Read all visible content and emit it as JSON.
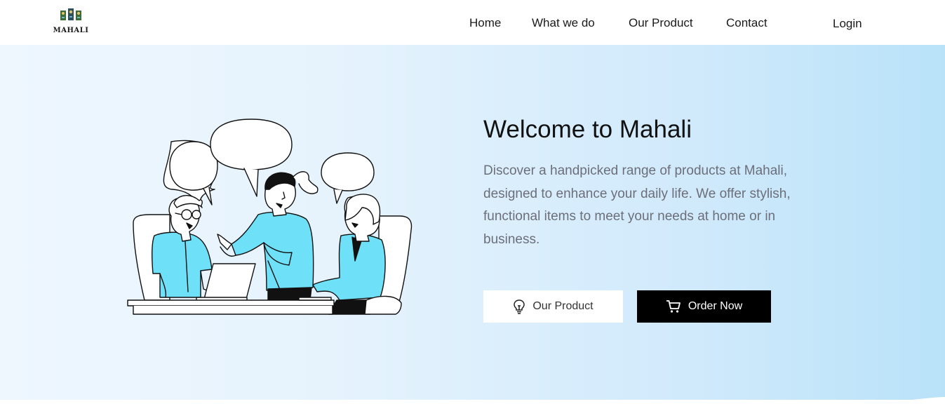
{
  "brand": {
    "name": "MAHALI"
  },
  "nav": {
    "home": "Home",
    "what_we_do": "What we do",
    "our_product": "Our Product",
    "contact": "Contact",
    "login": "Login"
  },
  "hero": {
    "title": "Welcome to Mahali",
    "description": "Discover a handpicked range of products at Mahali, designed to enhance your daily life. We offer stylish, functional items to meet your needs at home or in business.",
    "btn_product": {
      "label": "Our Product",
      "icon": "lightbulb-icon"
    },
    "btn_order": {
      "label": "Order Now",
      "icon": "cart-icon"
    }
  },
  "colors": {
    "accent_cyan": "#6ee0f7",
    "button_dark": "#000000",
    "hero_gradient_start": "#eef7fe",
    "hero_gradient_end": "#b9e2f9",
    "text_muted": "#6c6f79"
  }
}
